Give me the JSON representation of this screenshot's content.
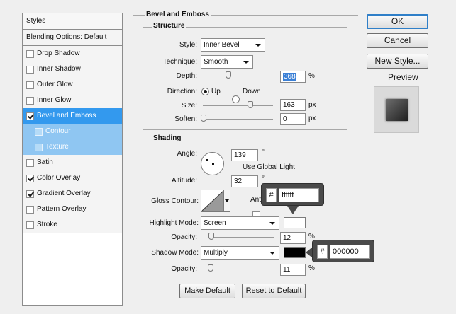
{
  "left_panel": {
    "header": "Styles",
    "blending_options": "Blending Options: Default",
    "items": [
      {
        "label": "Drop Shadow",
        "checked": false,
        "selected": false,
        "sub": false
      },
      {
        "label": "Inner Shadow",
        "checked": false,
        "selected": false,
        "sub": false
      },
      {
        "label": "Outer Glow",
        "checked": false,
        "selected": false,
        "sub": false
      },
      {
        "label": "Inner Glow",
        "checked": false,
        "selected": false,
        "sub": false
      },
      {
        "label": "Bevel and Emboss",
        "checked": true,
        "selected": true,
        "sub": false
      },
      {
        "label": "Contour",
        "checked": false,
        "selected": false,
        "sub": true
      },
      {
        "label": "Texture",
        "checked": false,
        "selected": false,
        "sub": true
      },
      {
        "label": "Satin",
        "checked": false,
        "selected": false,
        "sub": false
      },
      {
        "label": "Color Overlay",
        "checked": true,
        "selected": false,
        "sub": false
      },
      {
        "label": "Gradient Overlay",
        "checked": true,
        "selected": false,
        "sub": false
      },
      {
        "label": "Pattern Overlay",
        "checked": false,
        "selected": false,
        "sub": false
      },
      {
        "label": "Stroke",
        "checked": false,
        "selected": false,
        "sub": false
      }
    ]
  },
  "bevel": {
    "title": "Bevel and Emboss",
    "structure": {
      "title": "Structure",
      "style_label": "Style:",
      "style_value": "Inner Bevel",
      "technique_label": "Technique:",
      "technique_value": "Smooth",
      "depth_label": "Depth:",
      "depth_value": "368",
      "depth_unit": "%",
      "direction_label": "Direction:",
      "direction_up": "Up",
      "direction_down": "Down",
      "direction_selected": "Up",
      "size_label": "Size:",
      "size_value": "163",
      "size_unit": "px",
      "soften_label": "Soften:",
      "soften_value": "0",
      "soften_unit": "px"
    },
    "shading": {
      "title": "Shading",
      "angle_label": "Angle:",
      "angle_value": "139",
      "angle_unit": "°",
      "global_light_label": "Use Global Light",
      "global_light_checked": true,
      "altitude_label": "Altitude:",
      "altitude_value": "32",
      "altitude_unit": "°",
      "gloss_label": "Gloss Contour:",
      "antialiased_label": "Anti-aliased",
      "highlight_mode_label": "Highlight Mode:",
      "highlight_mode_value": "Screen",
      "highlight_color": "#ffffff",
      "highlight_opacity_label": "Opacity:",
      "highlight_opacity_value": "12",
      "highlight_opacity_unit": "%",
      "shadow_mode_label": "Shadow Mode:",
      "shadow_mode_value": "Multiply",
      "shadow_color": "#000000",
      "shadow_opacity_label": "Opacity:",
      "shadow_opacity_value": "11",
      "shadow_opacity_unit": "%"
    },
    "make_default": "Make Default",
    "reset_default": "Reset to Default"
  },
  "buttons": {
    "ok": "OK",
    "cancel": "Cancel",
    "new_style": "New Style...",
    "preview_label": "Preview",
    "preview_checked": true
  },
  "tooltips": {
    "highlight": {
      "hash": "#",
      "hex": "ffffff"
    },
    "shadow": {
      "hash": "#",
      "hex": "000000"
    }
  }
}
